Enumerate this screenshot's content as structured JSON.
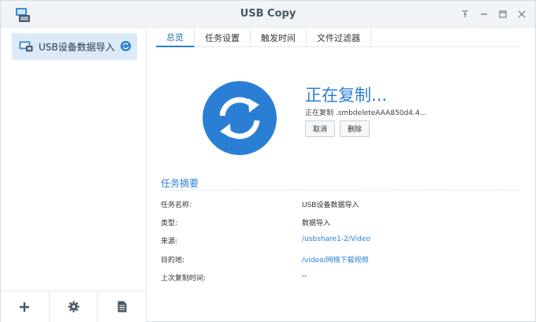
{
  "window": {
    "title": "USB Copy",
    "controls": [
      "pin-icon",
      "minimize-icon",
      "maximize-icon",
      "close-icon"
    ]
  },
  "sidebar": {
    "items": [
      {
        "label": "USB设备数据导入",
        "icon": "usb-device-icon",
        "status_icon": "sync-icon"
      }
    ],
    "bottom_buttons": [
      "add-icon",
      "gear-icon",
      "log-icon"
    ]
  },
  "tabs": [
    {
      "label": "总览",
      "active": true
    },
    {
      "label": "任务设置",
      "active": false
    },
    {
      "label": "触发时间",
      "active": false
    },
    {
      "label": "文件过滤器",
      "active": false
    }
  ],
  "status": {
    "title": "正在复制...",
    "detail": "正在复制 .smbdeleteAAA850d4.4...",
    "cancel_label": "取消",
    "delete_label": "删除"
  },
  "summary": {
    "title": "任务摘要",
    "rows": [
      {
        "key": "任务名称:",
        "value": "USB设备数据导入",
        "link": false
      },
      {
        "key": "类型:",
        "value": "数据导入",
        "link": false
      },
      {
        "key": "来源:",
        "value": "/usbshare1-2/Video",
        "link": true
      },
      {
        "key": "目的地:",
        "value": "/video/网络下载视频",
        "link": true
      },
      {
        "key": "上次复制时间:",
        "value": "--",
        "link": false
      }
    ]
  },
  "colors": {
    "accent": "#2a7fd4",
    "sidebar_selected": "#dceaf7",
    "titlebar": "#f0f4f8"
  }
}
